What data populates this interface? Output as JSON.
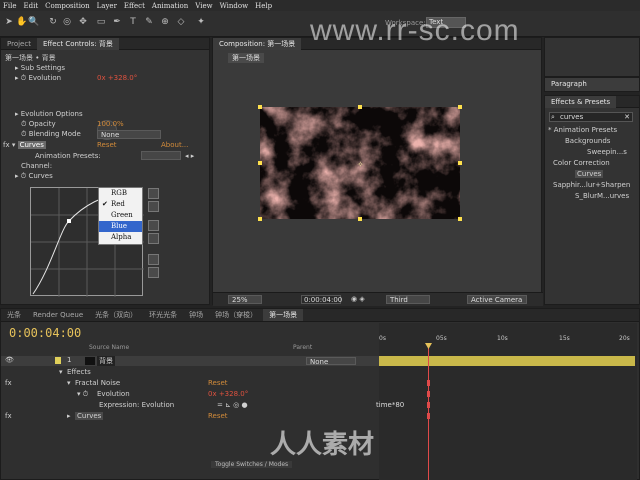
{
  "menu": [
    "File",
    "Edit",
    "Composition",
    "Layer",
    "Effect",
    "Animation",
    "View",
    "Window",
    "Help"
  ],
  "toolbar": {
    "workspace_label": "Workspace:",
    "workspace_value": "Text"
  },
  "left_panel": {
    "tabs": [
      "Project",
      "Effect Controls: 背景"
    ],
    "breadcrumb": "第一场景 • 背景",
    "sub_settings": "Sub Settings",
    "evolution_label": "Evolution",
    "evolution_value": "0x +328.0°",
    "evolution_options": "Evolution Options",
    "opacity_label": "Opacity",
    "opacity_value": "100.0%",
    "blending_label": "Blending Mode",
    "blending_value": "None",
    "curves_label": "Curves",
    "curves_reset": "Reset",
    "curves_about": "About...",
    "animation_presets_label": "Animation Presets:",
    "channel_label": "Channel:",
    "curves_sub": "Curves",
    "channel_options": [
      "RGB",
      "Red",
      "Green",
      "Blue",
      "Alpha"
    ],
    "channel_checked": "Red",
    "channel_highlighted": "Blue"
  },
  "comp_panel": {
    "tab": "Composition: 第一场景",
    "subtab": "第一场景",
    "zoom": "25%",
    "timecode": "0:00:04:00",
    "resolution": "Third",
    "camera": "Active Camera"
  },
  "right_panel": {
    "paragraph_tab": "Paragraph",
    "effects_tab": "Effects & Presets",
    "search_value": "curves",
    "tree": [
      "* Animation Presets",
      "Backgrounds",
      "Sweepin...s",
      "Color Correction",
      "Curves",
      "Sapphir...lur+Sharpen",
      "S_BlurM...urves"
    ]
  },
  "timeline": {
    "tabs": [
      "光条",
      "Render Queue",
      "光条（双向）",
      "环光光条",
      "钟场",
      "钟场（穿梭）",
      "第一场景"
    ],
    "timecode": "0:00:04:00",
    "col_source": "Source Name",
    "col_parent": "Parent",
    "layer_num": "1",
    "layer_name": "背景",
    "parent_value": "None",
    "rows": {
      "effects": "Effects",
      "fractal_noise": "Fractal Noise",
      "fractal_reset": "Reset",
      "evolution": "Evolution",
      "evolution_value": "0x +328.0°",
      "expression": "Expression: Evolution",
      "curves": "Curves",
      "curves_reset": "Reset"
    },
    "expression_text": "time*80",
    "ruler": [
      "0s",
      "05s",
      "10s",
      "15s",
      "20s"
    ],
    "toggle_label": "Toggle Switches / Modes"
  },
  "watermarks": {
    "top": "www.rr-sc.com",
    "bottom": "人人素材"
  }
}
